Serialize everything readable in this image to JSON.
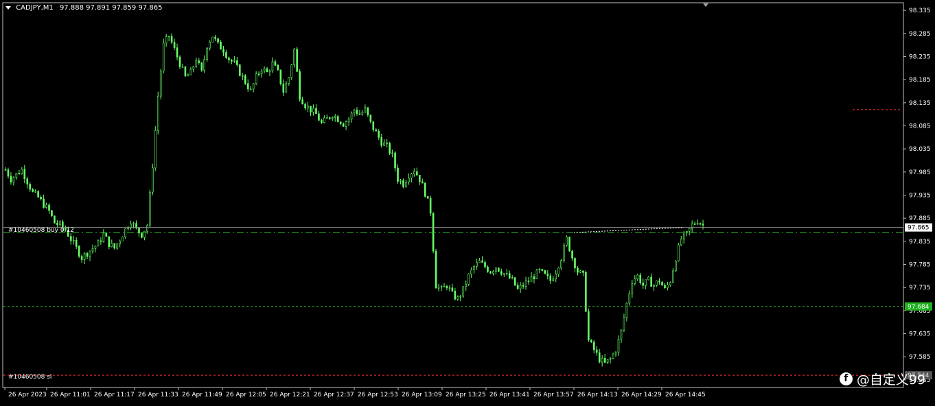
{
  "header": {
    "symbol": "CADJPY,M1",
    "ohlc": "97.888 97.891 97.859 97.865"
  },
  "colors": {
    "background": "#000000",
    "candle": "#66ff66",
    "grid_frame": "#c0c0c0",
    "bid_line": "#8c8c8c",
    "order_line": "#2fbf2f",
    "tp_line": "#2fbf2f",
    "sl_line": "#ff3030",
    "tp_badge": "#1fb01f"
  },
  "labels": {
    "order": "#10460508 buy 0.12",
    "sl": "#10460508 sl"
  },
  "watermark": {
    "icon": "facebook-icon",
    "text": "@自定义99"
  },
  "chart_data": {
    "type": "candlestick",
    "symbol": "CADJPY",
    "timeframe": "M1",
    "ylim": [
      97.52,
      98.35
    ],
    "y_ticks": [
      "98.335",
      "98.285",
      "98.235",
      "98.185",
      "98.135",
      "98.085",
      "98.035",
      "97.985",
      "97.935",
      "97.885",
      "97.835",
      "97.785",
      "97.735",
      "97.685",
      "97.635",
      "97.585",
      "97.535"
    ],
    "x_ticks": [
      "26 Apr 2023",
      "26 Apr 11:01",
      "26 Apr 11:17",
      "26 Apr 11:33",
      "26 Apr 11:49",
      "26 Apr 12:05",
      "26 Apr 12:21",
      "26 Apr 12:37",
      "26 Apr 12:53",
      "26 Apr 13:09",
      "26 Apr 13:25",
      "26 Apr 13:41",
      "26 Apr 13:57",
      "26 Apr 14:13",
      "26 Apr 14:29",
      "26 Apr 14:45"
    ],
    "price_badges": {
      "bid": "97.865",
      "tp": "97.684",
      "sl": "97.544"
    },
    "lines": {
      "bid": 97.865,
      "order_open": 97.854,
      "tp": 97.694,
      "sl": 97.545,
      "order_marker": 98.12
    },
    "close_path": [
      [
        0,
        97.99
      ],
      [
        2,
        97.97
      ],
      [
        4,
        97.98
      ],
      [
        6,
        97.99
      ],
      [
        8,
        97.965
      ],
      [
        10,
        97.94
      ],
      [
        12,
        97.93
      ],
      [
        14,
        97.915
      ],
      [
        16,
        97.9
      ],
      [
        18,
        97.875
      ],
      [
        20,
        97.87
      ],
      [
        22,
        97.86
      ],
      [
        24,
        97.84
      ],
      [
        26,
        97.82
      ],
      [
        28,
        97.8
      ],
      [
        30,
        97.81
      ],
      [
        32,
        97.82
      ],
      [
        34,
        97.83
      ],
      [
        36,
        97.85
      ],
      [
        38,
        97.83
      ],
      [
        40,
        97.82
      ],
      [
        42,
        97.84
      ],
      [
        44,
        97.86
      ],
      [
        46,
        97.88
      ],
      [
        48,
        97.86
      ],
      [
        50,
        97.85
      ],
      [
        52,
        97.87
      ],
      [
        54,
        98.0
      ],
      [
        56,
        98.15
      ],
      [
        58,
        98.26
      ],
      [
        60,
        98.28
      ],
      [
        62,
        98.25
      ],
      [
        64,
        98.22
      ],
      [
        66,
        98.19
      ],
      [
        68,
        98.2
      ],
      [
        70,
        98.23
      ],
      [
        72,
        98.2
      ],
      [
        74,
        98.26
      ],
      [
        76,
        98.28
      ],
      [
        78,
        98.26
      ],
      [
        80,
        98.25
      ],
      [
        82,
        98.23
      ],
      [
        84,
        98.22
      ],
      [
        86,
        98.2
      ],
      [
        88,
        98.18
      ],
      [
        90,
        98.16
      ],
      [
        92,
        98.19
      ],
      [
        94,
        98.21
      ],
      [
        96,
        98.2
      ],
      [
        98,
        98.22
      ],
      [
        100,
        98.2
      ],
      [
        102,
        98.16
      ],
      [
        104,
        98.19
      ],
      [
        106,
        98.25
      ],
      [
        108,
        98.15
      ],
      [
        110,
        98.13
      ],
      [
        112,
        98.12
      ],
      [
        114,
        98.11
      ],
      [
        116,
        98.09
      ],
      [
        118,
        98.1
      ],
      [
        120,
        98.11
      ],
      [
        122,
        98.1
      ],
      [
        124,
        98.09
      ],
      [
        126,
        98.1
      ],
      [
        128,
        98.12
      ],
      [
        130,
        98.11
      ],
      [
        132,
        98.12
      ],
      [
        134,
        98.09
      ],
      [
        136,
        98.07
      ],
      [
        138,
        98.05
      ],
      [
        140,
        98.04
      ],
      [
        142,
        98.02
      ],
      [
        144,
        97.97
      ],
      [
        146,
        97.96
      ],
      [
        148,
        97.98
      ],
      [
        150,
        97.99
      ],
      [
        152,
        97.97
      ],
      [
        154,
        97.94
      ],
      [
        156,
        97.9
      ],
      [
        158,
        97.74
      ],
      [
        160,
        97.73
      ],
      [
        162,
        97.74
      ],
      [
        164,
        97.72
      ],
      [
        166,
        97.71
      ],
      [
        168,
        97.73
      ],
      [
        170,
        97.76
      ],
      [
        172,
        97.78
      ],
      [
        174,
        97.79
      ],
      [
        176,
        97.78
      ],
      [
        178,
        97.77
      ],
      [
        180,
        97.78
      ],
      [
        182,
        97.77
      ],
      [
        184,
        97.76
      ],
      [
        186,
        97.75
      ],
      [
        188,
        97.73
      ],
      [
        190,
        97.74
      ],
      [
        192,
        97.75
      ],
      [
        194,
        97.76
      ],
      [
        196,
        97.77
      ],
      [
        198,
        97.76
      ],
      [
        200,
        97.75
      ],
      [
        202,
        97.77
      ],
      [
        204,
        97.8
      ],
      [
        206,
        97.84
      ],
      [
        208,
        97.8
      ],
      [
        210,
        97.77
      ],
      [
        212,
        97.76
      ],
      [
        214,
        97.62
      ],
      [
        216,
        97.6
      ],
      [
        218,
        97.58
      ],
      [
        220,
        97.57
      ],
      [
        222,
        97.58
      ],
      [
        224,
        97.6
      ],
      [
        226,
        97.64
      ],
      [
        228,
        97.7
      ],
      [
        230,
        97.75
      ],
      [
        232,
        97.76
      ],
      [
        234,
        97.74
      ],
      [
        236,
        97.75
      ],
      [
        238,
        97.74
      ],
      [
        240,
        97.75
      ],
      [
        242,
        97.73
      ],
      [
        244,
        97.75
      ],
      [
        246,
        97.8
      ],
      [
        248,
        97.84
      ],
      [
        250,
        97.85
      ],
      [
        252,
        97.87
      ],
      [
        254,
        97.88
      ],
      [
        256,
        97.87
      ]
    ]
  }
}
